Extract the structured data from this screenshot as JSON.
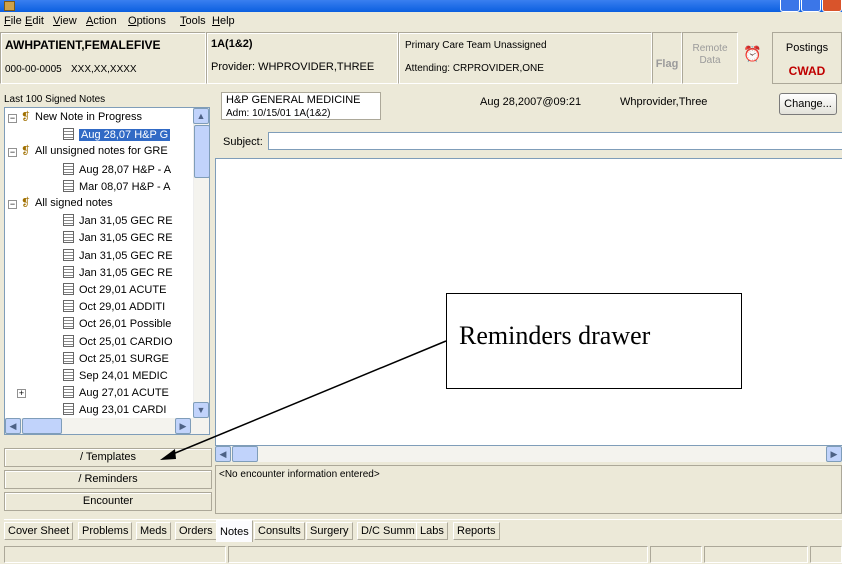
{
  "menu": [
    "File",
    "Edit",
    "View",
    "Action",
    "Options",
    "Tools",
    "Help"
  ],
  "patient": {
    "name": "AWHPATIENT,FEMALEFIVE",
    "ssn": "000-00-0005",
    "dob": "XXX,XX,XXXX"
  },
  "location": {
    "ward": "1A(1&2)",
    "provider": "Provider:  WHPROVIDER,THREE"
  },
  "care_team": {
    "team": "Primary Care Team Unassigned",
    "attending": "Attending:  CRPROVIDER,ONE"
  },
  "flag_label": "Flag",
  "remote_data": [
    "Remote",
    "Data"
  ],
  "postings": {
    "label": "Postings",
    "code": "CWAD"
  },
  "notes_panel": {
    "title": "Last 100 Signed Notes",
    "tree": [
      {
        "level": 0,
        "type": "group",
        "label": "New Note in Progress"
      },
      {
        "level": 1,
        "type": "note",
        "label": "Aug 28,07  H&P G",
        "selected": true
      },
      {
        "level": 0,
        "type": "group",
        "label": "All unsigned notes for GRE"
      },
      {
        "level": 1,
        "type": "note",
        "label": "Aug 28,07  H&P - A"
      },
      {
        "level": 1,
        "type": "note",
        "label": "Mar 08,07  H&P - A"
      },
      {
        "level": 0,
        "type": "group",
        "label": "All signed notes"
      },
      {
        "level": 1,
        "type": "note",
        "label": "Jan 31,05  GEC RE"
      },
      {
        "level": 1,
        "type": "note",
        "label": "Jan 31,05  GEC RE"
      },
      {
        "level": 1,
        "type": "note",
        "label": "Jan 31,05  GEC RE"
      },
      {
        "level": 1,
        "type": "note",
        "label": "Jan 31,05  GEC RE"
      },
      {
        "level": 1,
        "type": "note",
        "label": "Oct 29,01  ACUTE"
      },
      {
        "level": 1,
        "type": "note",
        "label": "Oct 29,01  ADDITI"
      },
      {
        "level": 1,
        "type": "note",
        "label": "Oct 26,01  Possible"
      },
      {
        "level": 1,
        "type": "note",
        "label": "Oct 25,01  CARDIO"
      },
      {
        "level": 1,
        "type": "note",
        "label": "Oct 25,01  SURGE"
      },
      {
        "level": 1,
        "type": "note",
        "label": "Sep 24,01  MEDIC"
      },
      {
        "level": 1,
        "type": "note-group",
        "label": "Aug 27,01  ACUTE"
      },
      {
        "level": 1,
        "type": "note",
        "label": "Aug 23,01  CARDI"
      }
    ]
  },
  "drawers": {
    "templates": "/ Templates",
    "reminders": "/ Reminders",
    "encounter": "Encounter"
  },
  "note": {
    "title": "H&P GENERAL MEDICINE",
    "adm": "Adm: 10/15/01  1A(1&2)",
    "date": "Aug 28,2007@09:21",
    "author": "Whprovider,Three",
    "change_label": "Change...",
    "subject_label": "Subject:",
    "subject_value": ""
  },
  "encounter_info": "<No encounter information entered>",
  "tabs": [
    "Cover Sheet",
    "Problems",
    "Meds",
    "Orders",
    "Notes",
    "Consults",
    "Surgery",
    "D/C Summ",
    "Labs",
    "Reports"
  ],
  "active_tab": "Notes",
  "callout": {
    "text": "Reminders drawer"
  }
}
